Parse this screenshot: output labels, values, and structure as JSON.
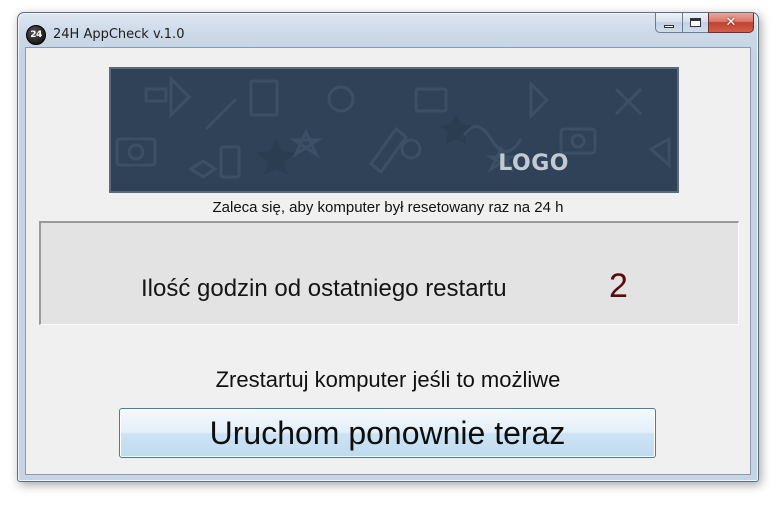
{
  "window": {
    "title": "24H AppCheck v.1.0",
    "icon_name": "app-24h-icon",
    "icon_text": "24"
  },
  "caption_buttons": {
    "minimize_icon": "minimize-icon",
    "maximize_icon": "maximize-icon",
    "close_icon": "close-icon",
    "close_glyph": "✕"
  },
  "banner": {
    "logo_text": "LOGO",
    "background_color": "#2f4257"
  },
  "main": {
    "recommendation": "Zaleca się, aby komputer był resetowany raz na 24 h",
    "hours_label": "Ilość godzin od ostatniego restartu",
    "hours_value": "2",
    "hours_value_color": "#5a0a0a",
    "hint": "Zrestartuj komputer jeśli to możliwe",
    "restart_button_label": "Uruchom ponownie teraz"
  }
}
